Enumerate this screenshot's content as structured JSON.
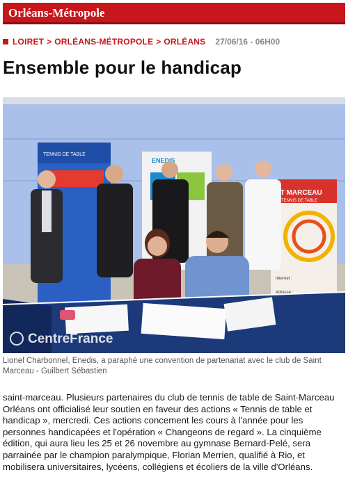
{
  "header": {
    "section_title": "Orléans-Métropole"
  },
  "breadcrumb": {
    "items": [
      "LOIRET",
      "ORLÉANS-MÉTROPOLE",
      "ORLÉANS"
    ],
    "separator": ">",
    "date": "27/06/16 - 06H00"
  },
  "article": {
    "title": "Ensemble pour le handicap",
    "photo": {
      "watermark": "CentreFrance",
      "banner_left": "TENNIS DE TABLE",
      "banner_middle": "ENEDIS",
      "banner_right_lines": [
        "ST MARCEAU",
        "TENNIS DE TABLE",
        "Internet :",
        "Adresse :"
      ]
    },
    "caption": "Lionel Charbonnel, Enedis, a paraphé une convention de partenariat avec le club de Saint Marceau - Guilbert Sébastien",
    "body": "saint-marceau. Plusieurs partenaires du club de tennis de table de Saint-Marceau Orléans ont officialisé leur soutien en faveur des actions « Tennis de table et handicap », mercredi. Ces actions concement les cours à l'année pour les personnes handicapées et l'opération « Changeons de regard ». La cinquième édition, qui aura lieu les 25 et 26 novembre au gymnase Bernard-Pelé, sera parrainée par le champion paralympique, Florian Merrien, qualifié à Rio, et mobilisera universitaires, lycéens, collégiens et écoliers de la ville d'Orléans."
  },
  "colors": {
    "brand_red": "#c8161d",
    "banner_dark": "#8e0d12"
  }
}
